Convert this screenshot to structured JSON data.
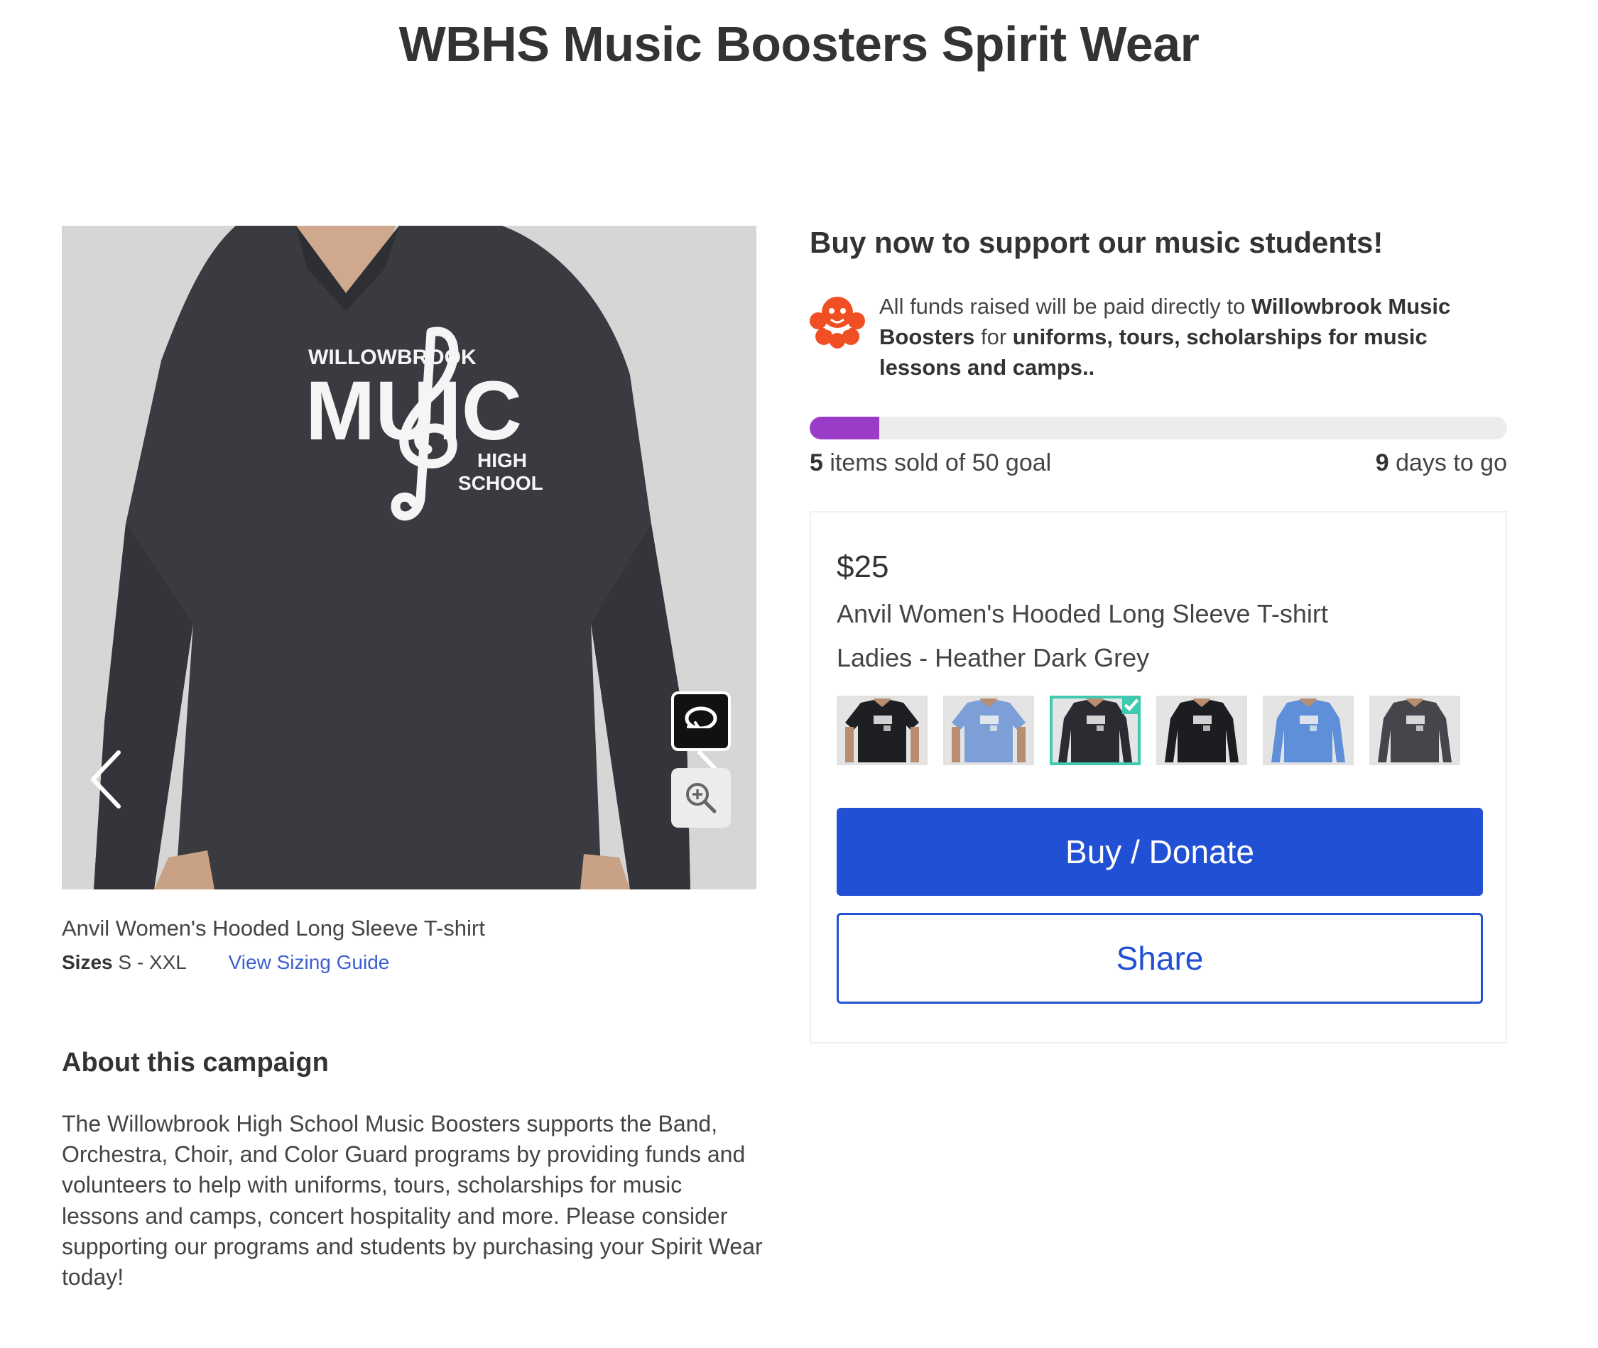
{
  "page": {
    "title": "WBHS Music Boosters Spirit Wear"
  },
  "gallery": {
    "print_text": {
      "top": "WILLOWBROOK",
      "main_left": "MU",
      "main_right": "IC",
      "high": "HIGH",
      "school": "SCHOOL"
    },
    "icons": {
      "prev": "chevron-left-icon",
      "next": "chevron-right-icon",
      "rotate": "rotate-360-icon",
      "zoom": "zoom-in-icon"
    },
    "shirt_color": "#3a3b40",
    "background_color": "#d8d8d8"
  },
  "product": {
    "caption": "Anvil Women's Hooded Long Sleeve T-shirt",
    "sizes_label": "Sizes",
    "sizes_value": "S - XXL",
    "sizing_link": "View Sizing Guide"
  },
  "about": {
    "heading": "About this campaign",
    "text": "The Willowbrook High School Music Boosters supports the Band, Orchestra, Choir, and Color Guard programs by providing funds and volunteers to help with uniforms, tours, scholarships for music lessons and camps, concert hospitality and more. Please consider supporting our programs and students by purchasing your Spirit Wear today!"
  },
  "support": {
    "heading": "Buy now to support our music students!",
    "funds_prefix": "All funds raised will be paid directly to ",
    "funds_org": "Willowbrook Music Boosters",
    "funds_mid": " for ",
    "funds_purpose": "uniforms, tours, scholarships for music lessons and camps.",
    "funds_suffix": "."
  },
  "progress": {
    "sold": "5",
    "sold_text": " items sold of 50 goal",
    "days": "9",
    "days_text": " days to go",
    "fraction": 0.1,
    "color": "#9b3cc9"
  },
  "card": {
    "price": "$25",
    "name": "Anvil Women's Hooded Long Sleeve T-shirt",
    "variant": "Ladies - Heather Dark Grey",
    "thumbnails": [
      {
        "color": "#1e1f22",
        "style": "tee"
      },
      {
        "color": "#7b9fd6",
        "style": "tee"
      },
      {
        "color": "#2a2c31",
        "style": "hoodie",
        "selected": true
      },
      {
        "color": "#1c1d20",
        "style": "long"
      },
      {
        "color": "#5f8fd8",
        "style": "long"
      },
      {
        "color": "#44464b",
        "style": "long"
      }
    ],
    "buy_label": "Buy / Donate",
    "share_label": "Share",
    "accent_color": "#2150d4",
    "selected_color": "#3ec9b0"
  }
}
